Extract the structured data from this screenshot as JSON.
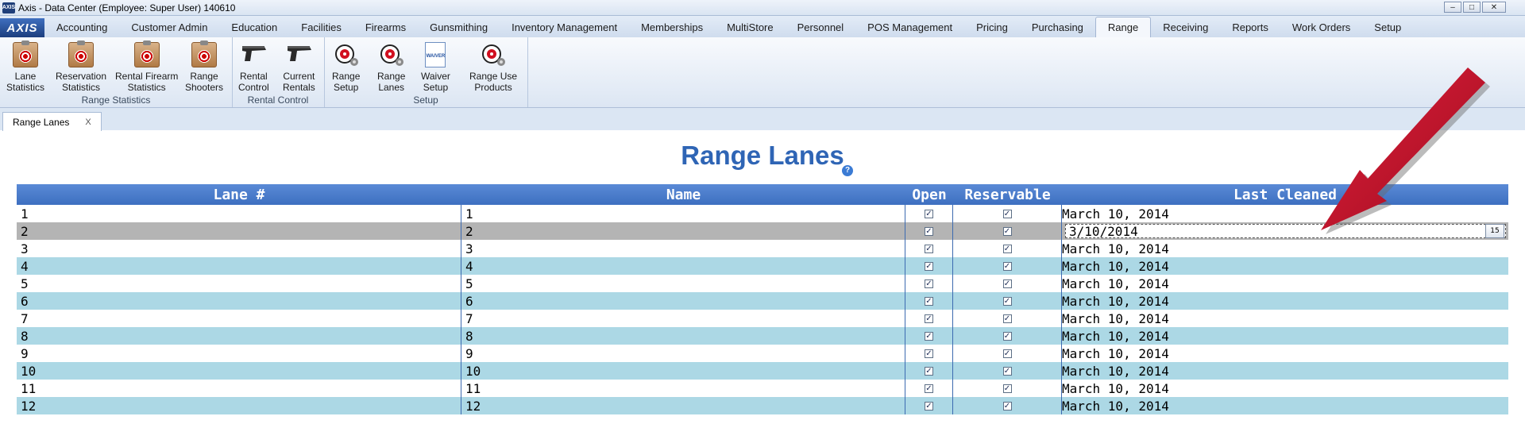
{
  "window": {
    "title": "Axis - Data Center  (Employee: Super User) 140610",
    "logo": "AXIS"
  },
  "menu": {
    "tabs": [
      "Accounting",
      "Customer Admin",
      "Education",
      "Facilities",
      "Firearms",
      "Gunsmithing",
      "Inventory Management",
      "Memberships",
      "MultiStore",
      "Personnel",
      "POS Management",
      "Pricing",
      "Purchasing",
      "Range",
      "Receiving",
      "Reports",
      "Work Orders",
      "Setup"
    ],
    "active": "Range"
  },
  "ribbon": {
    "groups": [
      {
        "label": "Range Statistics",
        "buttons": [
          {
            "line1": "Lane",
            "line2": "Statistics",
            "icon": "clipboard-target-icon"
          },
          {
            "line1": "Reservation",
            "line2": "Statistics",
            "icon": "clipboard-target-icon"
          },
          {
            "line1": "Rental Firearm",
            "line2": "Statistics",
            "icon": "clipboard-gun-icon"
          },
          {
            "line1": "Range",
            "line2": "Shooters",
            "icon": "clipboard-shooter-icon"
          }
        ]
      },
      {
        "label": "Rental Control",
        "buttons": [
          {
            "line1": "Rental",
            "line2": "Control",
            "icon": "pistol-icon"
          },
          {
            "line1": "Current",
            "line2": "Rentals",
            "icon": "pistol-icon"
          }
        ]
      },
      {
        "label": "Setup",
        "buttons": [
          {
            "line1": "Range",
            "line2": "Setup",
            "icon": "target-gear-icon"
          },
          {
            "line1": "Range",
            "line2": "Lanes",
            "icon": "target-gear-icon"
          },
          {
            "line1": "Waiver",
            "line2": "Setup",
            "icon": "waiver-document-icon",
            "icon_text": "WAIVER"
          },
          {
            "line1": "Range Use",
            "line2": "Products",
            "icon": "target-gear-icon"
          }
        ]
      }
    ]
  },
  "doc_tab": {
    "label": "Range Lanes",
    "close": "X"
  },
  "page": {
    "title": "Range Lanes",
    "help": "?"
  },
  "grid": {
    "columns": [
      "Lane #",
      "Name",
      "Open",
      "Reservable",
      "Last Cleaned"
    ],
    "rows": [
      {
        "lane": "1",
        "name": "1",
        "open": true,
        "reservable": true,
        "last_cleaned": "March 10, 2014"
      },
      {
        "lane": "2",
        "name": "2",
        "open": true,
        "reservable": true,
        "last_cleaned": "3/10/2014",
        "editing": true,
        "calendar_day": "15"
      },
      {
        "lane": "3",
        "name": "3",
        "open": true,
        "reservable": true,
        "last_cleaned": "March 10, 2014"
      },
      {
        "lane": "4",
        "name": "4",
        "open": true,
        "reservable": true,
        "last_cleaned": "March 10, 2014"
      },
      {
        "lane": "5",
        "name": "5",
        "open": true,
        "reservable": true,
        "last_cleaned": "March 10, 2014"
      },
      {
        "lane": "6",
        "name": "6",
        "open": true,
        "reservable": true,
        "last_cleaned": "March 10, 2014"
      },
      {
        "lane": "7",
        "name": "7",
        "open": true,
        "reservable": true,
        "last_cleaned": "March 10, 2014"
      },
      {
        "lane": "8",
        "name": "8",
        "open": true,
        "reservable": true,
        "last_cleaned": "March 10, 2014"
      },
      {
        "lane": "9",
        "name": "9",
        "open": true,
        "reservable": true,
        "last_cleaned": "March 10, 2014"
      },
      {
        "lane": "10",
        "name": "10",
        "open": true,
        "reservable": true,
        "last_cleaned": "March 10, 2014"
      },
      {
        "lane": "11",
        "name": "11",
        "open": true,
        "reservable": true,
        "last_cleaned": "March 10, 2014"
      },
      {
        "lane": "12",
        "name": "12",
        "open": true,
        "reservable": true,
        "last_cleaned": "March 10, 2014"
      }
    ]
  },
  "colors": {
    "accent": "#2f65b5",
    "header": "#4a7cca",
    "row_alt": "#acd8e5",
    "row_selected": "#b4b4b4",
    "arrow": "#c8102e"
  }
}
